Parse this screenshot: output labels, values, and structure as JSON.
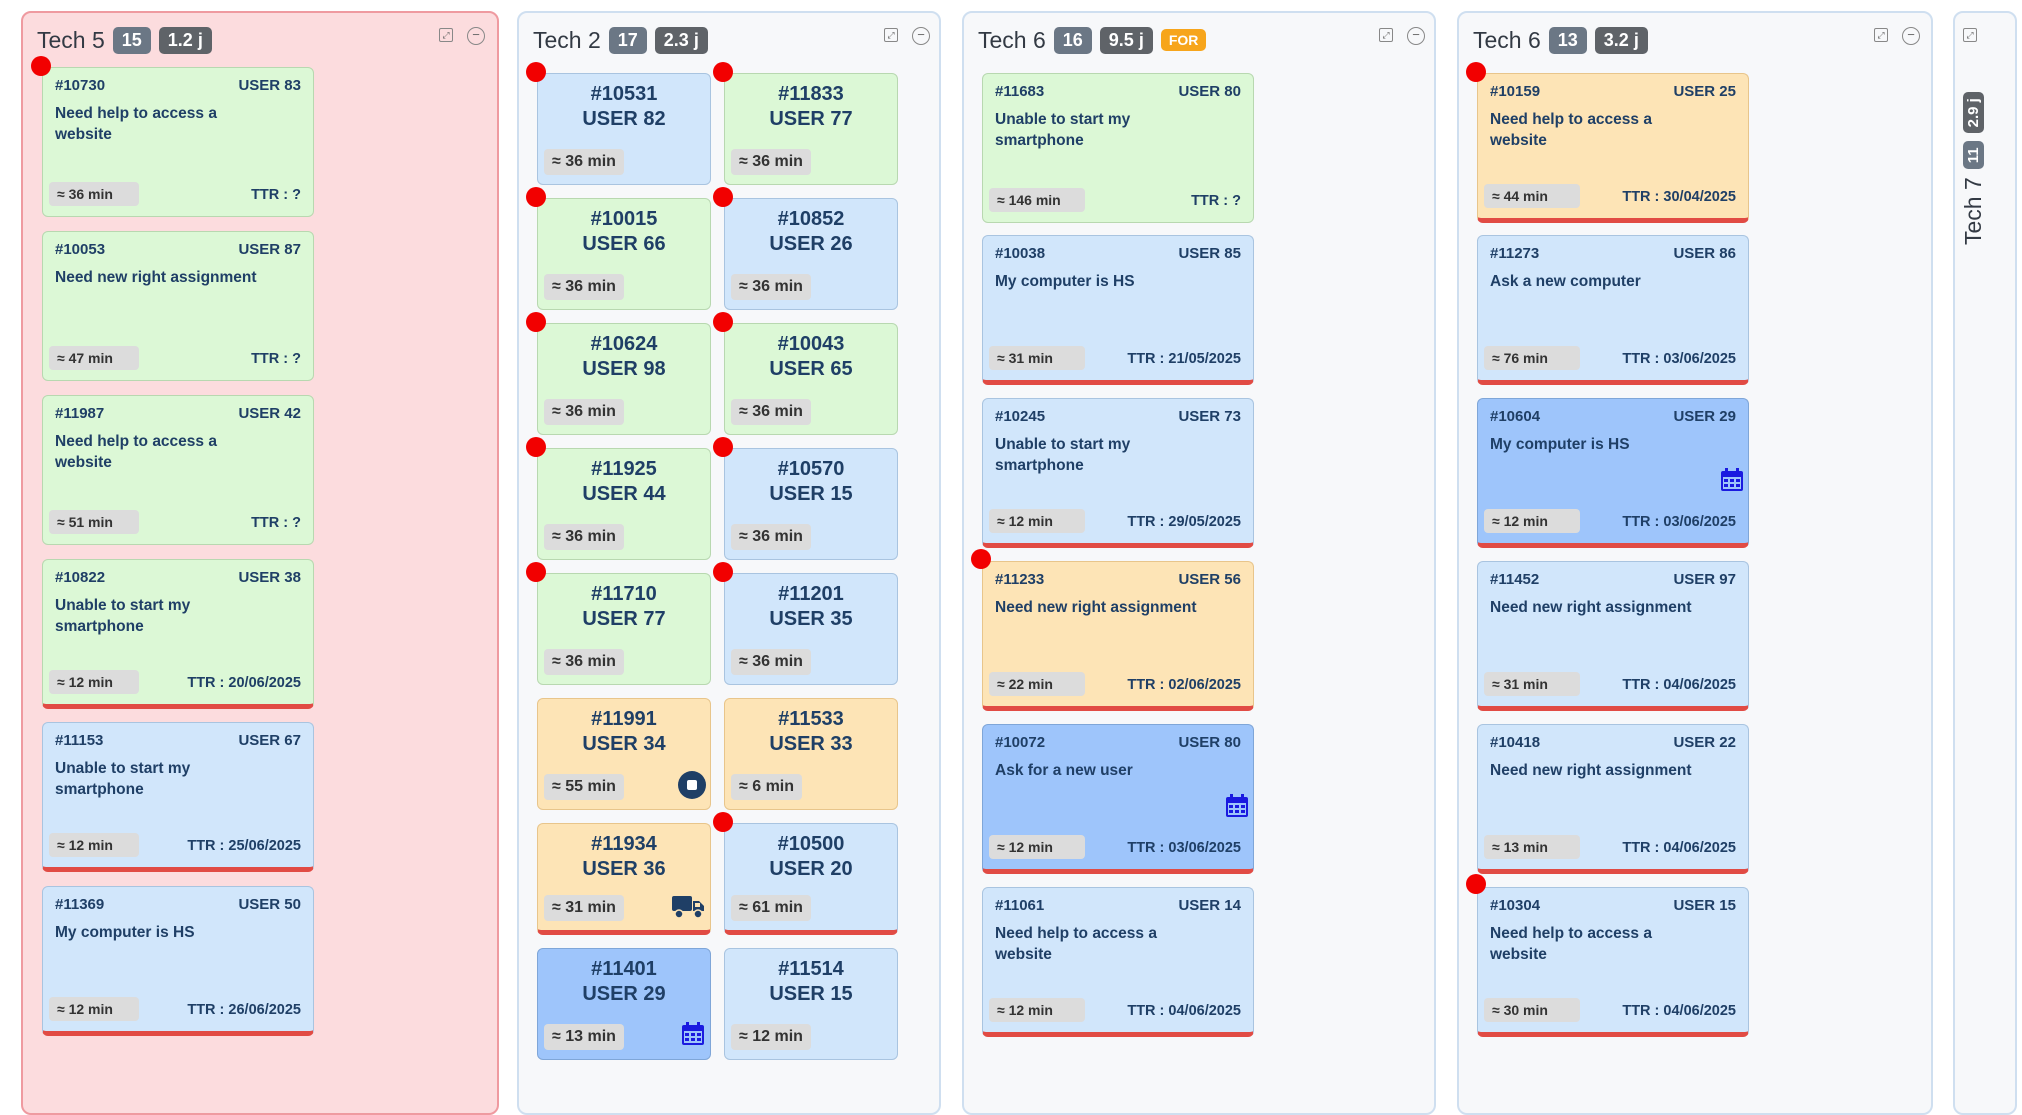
{
  "colors": {
    "green": "#dcf8d6",
    "blue": "#d1e6fb",
    "dark_blue": "#9ec5fb",
    "orange": "#fde4b6",
    "alert_red": "#e14b44",
    "dot_red": "#f20000",
    "column_alert_bg": "#fcdcde"
  },
  "columns": [
    {
      "title": "Tech 5",
      "count": "15",
      "time": "1.2 j",
      "flag": "",
      "cards": [
        {
          "id": "#10730",
          "user": "USER 83",
          "text": "Need help to access a website",
          "duration": "≈ 36 min",
          "ttr": "TTR : ?"
        },
        {
          "id": "#10053",
          "user": "USER 87",
          "text": "Need new right assignment",
          "duration": "≈ 47 min",
          "ttr": "TTR : ?"
        },
        {
          "id": "#11987",
          "user": "USER 42",
          "text": "Need help to access a website",
          "duration": "≈ 51 min",
          "ttr": "TTR : ?"
        },
        {
          "id": "#10822",
          "user": "USER 38",
          "text": "Unable to start my smartphone",
          "duration": "≈ 12 min",
          "ttr": "TTR : 20/06/2025"
        },
        {
          "id": "#11153",
          "user": "USER 67",
          "text": "Unable to start my smartphone",
          "duration": "≈ 12 min",
          "ttr": "TTR : 25/06/2025"
        },
        {
          "id": "#11369",
          "user": "USER 50",
          "text": "My computer is HS",
          "duration": "≈ 12 min",
          "ttr": "TTR : 26/06/2025"
        }
      ]
    },
    {
      "title": "Tech 2",
      "count": "17",
      "time": "2.3 j",
      "flag": "",
      "cards": [
        {
          "id": "#10531",
          "user": "USER 82",
          "duration": "≈ 36 min"
        },
        {
          "id": "#11833",
          "user": "USER 77",
          "duration": "≈ 36 min"
        },
        {
          "id": "#10015",
          "user": "USER 66",
          "duration": "≈ 36 min"
        },
        {
          "id": "#10852",
          "user": "USER 26",
          "duration": "≈ 36 min"
        },
        {
          "id": "#10624",
          "user": "USER 98",
          "duration": "≈ 36 min"
        },
        {
          "id": "#10043",
          "user": "USER 65",
          "duration": "≈ 36 min"
        },
        {
          "id": "#11925",
          "user": "USER 44",
          "duration": "≈ 36 min"
        },
        {
          "id": "#10570",
          "user": "USER 15",
          "duration": "≈ 36 min"
        },
        {
          "id": "#11710",
          "user": "USER 77",
          "duration": "≈ 36 min"
        },
        {
          "id": "#11201",
          "user": "USER 35",
          "duration": "≈ 36 min"
        },
        {
          "id": "#11991",
          "user": "USER 34",
          "duration": "≈ 55 min"
        },
        {
          "id": "#11533",
          "user": "USER 33",
          "duration": "≈ 6 min"
        },
        {
          "id": "#11934",
          "user": "USER 36",
          "duration": "≈ 31 min"
        },
        {
          "id": "#10500",
          "user": "USER 20",
          "duration": "≈ 61 min"
        },
        {
          "id": "#11401",
          "user": "USER 29",
          "duration": "≈ 13 min"
        },
        {
          "id": "#11514",
          "user": "USER 15",
          "duration": "≈ 12 min"
        }
      ]
    },
    {
      "title": "Tech 6",
      "count": "16",
      "time": "9.5 j",
      "flag": "FOR",
      "cards": [
        {
          "id": "#11683",
          "user": "USER 80",
          "text": "Unable to start my smartphone",
          "duration": "≈ 146 min",
          "ttr": "TTR : ?"
        },
        {
          "id": "#10038",
          "user": "USER 85",
          "text": "My computer is HS",
          "duration": "≈ 31 min",
          "ttr": "TTR : 21/05/2025"
        },
        {
          "id": "#10245",
          "user": "USER 73",
          "text": "Unable to start my smartphone",
          "duration": "≈ 12 min",
          "ttr": "TTR : 29/05/2025"
        },
        {
          "id": "#11233",
          "user": "USER 56",
          "text": "Need new right assignment",
          "duration": "≈ 22 min",
          "ttr": "TTR : 02/06/2025"
        },
        {
          "id": "#10072",
          "user": "USER 80",
          "text": "Ask for a new user",
          "duration": "≈ 12 min",
          "ttr": "TTR : 03/06/2025"
        },
        {
          "id": "#11061",
          "user": "USER 14",
          "text": "Need help to access a website",
          "duration": "≈ 12 min",
          "ttr": "TTR : 04/06/2025"
        }
      ]
    },
    {
      "title": "Tech 6",
      "count": "13",
      "time": "3.2 j",
      "flag": "",
      "cards": [
        {
          "id": "#10159",
          "user": "USER 25",
          "text": "Need help to access a website",
          "duration": "≈ 44 min",
          "ttr": "TTR : 30/04/2025"
        },
        {
          "id": "#11273",
          "user": "USER 86",
          "text": "Ask a new computer",
          "duration": "≈ 76 min",
          "ttr": "TTR : 03/06/2025"
        },
        {
          "id": "#10604",
          "user": "USER 29",
          "text": "My computer is HS",
          "duration": "≈ 12 min",
          "ttr": "TTR : 03/06/2025"
        },
        {
          "id": "#11452",
          "user": "USER 97",
          "text": "Need new right assignment",
          "duration": "≈ 31 min",
          "ttr": "TTR : 04/06/2025"
        },
        {
          "id": "#10418",
          "user": "USER 22",
          "text": "Need new right assignment",
          "duration": "≈ 13 min",
          "ttr": "TTR : 04/06/2025"
        },
        {
          "id": "#10304",
          "user": "USER 15",
          "text": "Need help to access a website",
          "duration": "≈ 30 min",
          "ttr": "TTR : 04/06/2025"
        }
      ]
    },
    {
      "title": "Tech 7",
      "count": "11",
      "time": "2.9 j",
      "flag": ""
    }
  ]
}
